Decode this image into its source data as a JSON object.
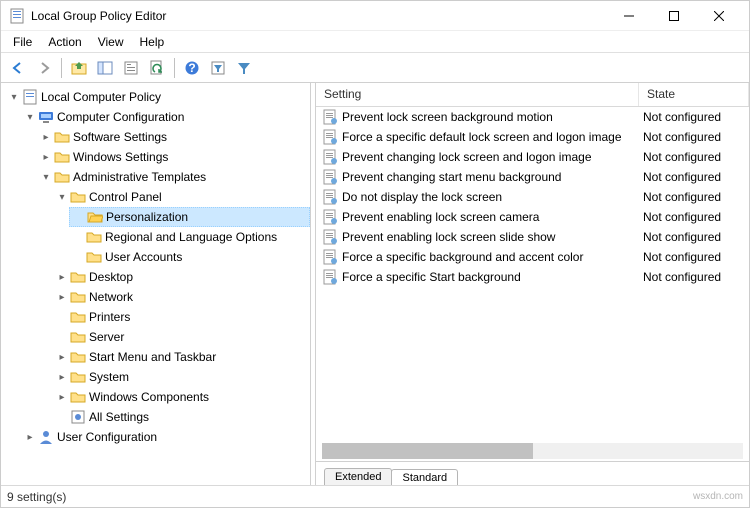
{
  "window": {
    "title": "Local Group Policy Editor"
  },
  "menus": [
    "File",
    "Action",
    "View",
    "Help"
  ],
  "toolbar_icons": [
    "back",
    "forward",
    "up",
    "show-tree",
    "properties",
    "refresh",
    "export",
    "help",
    "filter-options",
    "filter"
  ],
  "tree": {
    "root": {
      "label": "Local Computer Policy"
    },
    "cc": {
      "label": "Computer Configuration"
    },
    "sw": {
      "label": "Software Settings"
    },
    "ws": {
      "label": "Windows Settings"
    },
    "at": {
      "label": "Administrative Templates"
    },
    "cp": {
      "label": "Control Panel"
    },
    "pers": {
      "label": "Personalization"
    },
    "rlo": {
      "label": "Regional and Language Options"
    },
    "ua": {
      "label": "User Accounts"
    },
    "desk": {
      "label": "Desktop"
    },
    "net": {
      "label": "Network"
    },
    "prt": {
      "label": "Printers"
    },
    "srv": {
      "label": "Server"
    },
    "smt": {
      "label": "Start Menu and Taskbar"
    },
    "sys": {
      "label": "System"
    },
    "wc": {
      "label": "Windows Components"
    },
    "as": {
      "label": "All Settings"
    },
    "uc": {
      "label": "User Configuration"
    }
  },
  "list": {
    "header": {
      "setting": "Setting",
      "state": "State"
    },
    "rows": [
      {
        "setting": "Prevent lock screen background motion",
        "state": "Not configured"
      },
      {
        "setting": "Force a specific default lock screen and logon image",
        "state": "Not configured"
      },
      {
        "setting": "Prevent changing lock screen and logon image",
        "state": "Not configured"
      },
      {
        "setting": "Prevent changing start menu background",
        "state": "Not configured"
      },
      {
        "setting": "Do not display the lock screen",
        "state": "Not configured"
      },
      {
        "setting": "Prevent enabling lock screen camera",
        "state": "Not configured"
      },
      {
        "setting": "Prevent enabling lock screen slide show",
        "state": "Not configured"
      },
      {
        "setting": "Force a specific background and accent color",
        "state": "Not configured"
      },
      {
        "setting": "Force a specific Start background",
        "state": "Not configured"
      }
    ]
  },
  "tabs": {
    "extended": "Extended",
    "standard": "Standard"
  },
  "status": {
    "count": "9 setting(s)"
  },
  "watermark": "wsxdn.com"
}
